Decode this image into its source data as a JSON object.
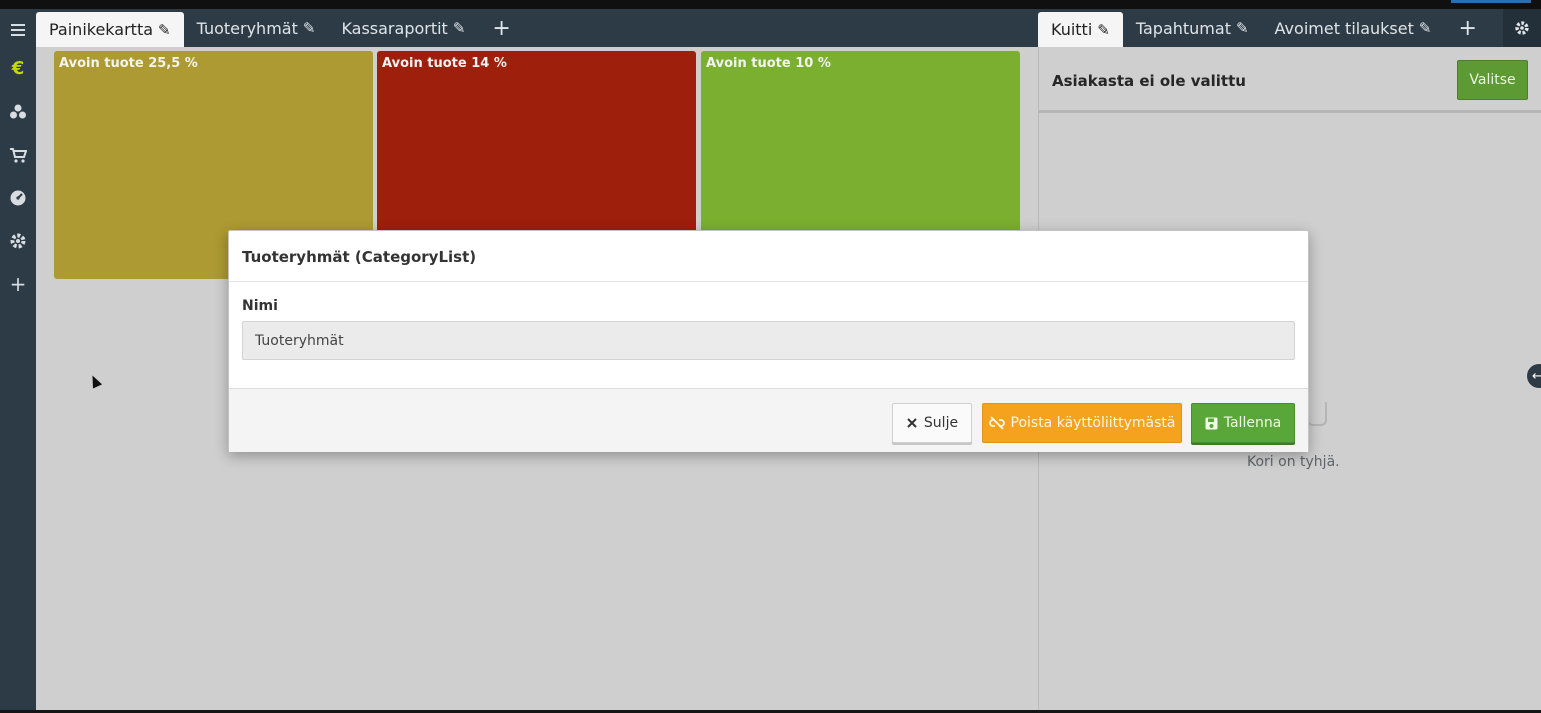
{
  "left_tabs": [
    {
      "label": "Painikekartta",
      "active": true
    },
    {
      "label": "Tuoteryhmät",
      "active": false
    },
    {
      "label": "Kassaraportit",
      "active": false
    }
  ],
  "right_tabs": [
    {
      "label": "Kuitti",
      "active": true
    },
    {
      "label": "Tapahtumat",
      "active": false
    },
    {
      "label": "Avoimet tilaukset",
      "active": false
    }
  ],
  "sidebar": {
    "items": [
      {
        "icon": "euro-icon",
        "glyph": "€"
      },
      {
        "icon": "boxes-icon"
      },
      {
        "icon": "cart-icon"
      },
      {
        "icon": "dashboard-icon"
      },
      {
        "icon": "gear-icon"
      },
      {
        "icon": "plus-icon",
        "glyph": "+"
      }
    ]
  },
  "tiles": [
    {
      "label": "Avoin tuote 25,5 %",
      "color": "#ad9a32"
    },
    {
      "label": "Avoin tuote 14 %",
      "color": "#9e1f0b"
    },
    {
      "label": "Avoin tuote 10 %",
      "color": "#7aaf2f"
    }
  ],
  "customer": {
    "label": "Asiakasta ei ole valittu",
    "select_button": "Valitse"
  },
  "cart": {
    "empty_text": "Kori on tyhjä."
  },
  "modal": {
    "title": "Tuoteryhmät (CategoryList)",
    "field_label": "Nimi",
    "field_value": "Tuoteryhmät",
    "close_button": "Sulje",
    "remove_button": "Poista käyttöliittymästä",
    "save_button": "Tallenna"
  },
  "colors": {
    "sidebar_bg": "#2d3b46",
    "accent_active": "#c3d800",
    "save_green": "#5aa739",
    "remove_orange": "#f5a31e"
  }
}
